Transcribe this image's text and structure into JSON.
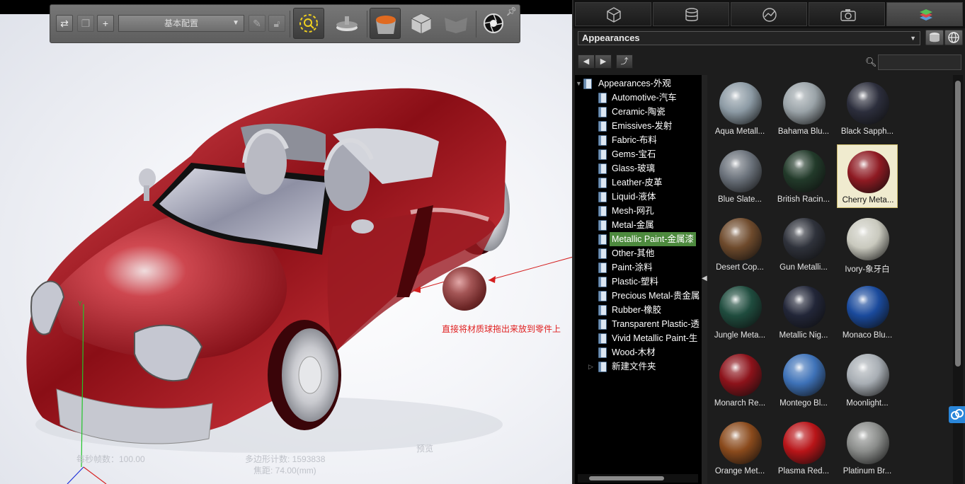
{
  "toolbar": {
    "config_value": "基本配置"
  },
  "viewport": {
    "annotation_text": "直接将材质球拖出来放到零件上",
    "status": {
      "fps": "每秒帧数：100.00",
      "polygons": "多边形计数: 1593838",
      "focal": "焦距: 74.00(mm)",
      "preview": "预览"
    },
    "axis_label": "Y",
    "drag_ball_color": "#a45656"
  },
  "panel": {
    "tabs": [
      "model-icon",
      "scene-icon",
      "lighting-icon",
      "camera-icon",
      "appearances-icon"
    ],
    "active_tab": 4,
    "library_select": "Appearances",
    "search_placeholder": "",
    "tree": {
      "root": "Appearances-外观",
      "items": [
        "Automotive-汽车",
        "Ceramic-陶瓷",
        "Emissives-发射",
        "Fabric-布料",
        "Gems-宝石",
        "Glass-玻璃",
        "Leather-皮革",
        "Liquid-液体",
        "Mesh-网孔",
        "Metal-金属",
        "Metallic Paint-金属漆",
        "Other-其他",
        "Paint-涂料",
        "Plastic-塑料",
        "Precious Metal-贵金属",
        "Rubber-橡胶",
        "Transparent Plastic-透",
        "Vivid Metallic Paint-生",
        "Wood-木材",
        "新建文件夹"
      ],
      "selected_index": 10
    },
    "materials": [
      {
        "name": "Aqua Metall...",
        "color": "#8c9aa4"
      },
      {
        "name": "Bahama Blu...",
        "color": "#9aa3a8"
      },
      {
        "name": "Black Sapph...",
        "color": "#2c2e3c"
      },
      {
        "name": "Blue Slate...",
        "color": "#6a717a"
      },
      {
        "name": "British Racin...",
        "color": "#223a2a"
      },
      {
        "name": "Cherry Meta...",
        "color": "#8e1a22"
      },
      {
        "name": "Desert Cop...",
        "color": "#6e4a2c"
      },
      {
        "name": "Gun Metalli...",
        "color": "#2f323b"
      },
      {
        "name": "Ivory-象牙白",
        "color": "#c9c9be"
      },
      {
        "name": "Jungle Meta...",
        "color": "#1f4c3e"
      },
      {
        "name": "Metallic Nig...",
        "color": "#222638"
      },
      {
        "name": "Monaco Blu...",
        "color": "#1a4a9c"
      },
      {
        "name": "Monarch Re...",
        "color": "#8c121a"
      },
      {
        "name": "Montego Bl...",
        "color": "#3e72b8"
      },
      {
        "name": "Moonlight...",
        "color": "#a8aeb4"
      },
      {
        "name": "Orange Met...",
        "color": "#8a4a1c"
      },
      {
        "name": "Plasma Red...",
        "color": "#b81418"
      },
      {
        "name": "Platinum Br...",
        "color": "#8a8c8a"
      }
    ],
    "selected_material": 5
  }
}
